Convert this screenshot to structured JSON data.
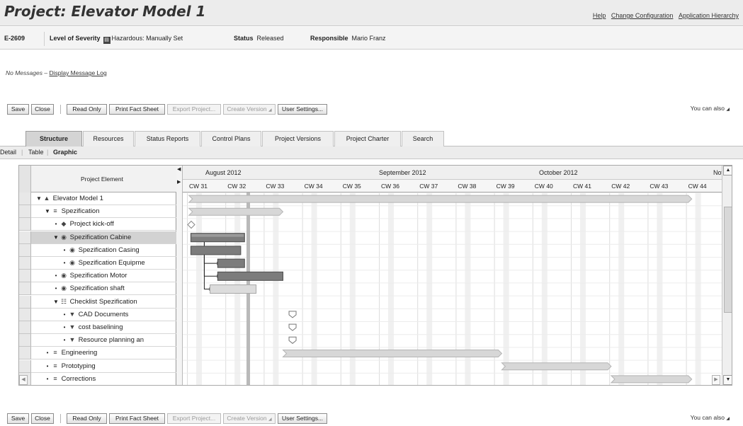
{
  "app": {
    "title": "Project: Elevator Model 1"
  },
  "top_links": [
    "Help",
    "Change Configuration",
    "Application Hierarchy"
  ],
  "header": {
    "id": "E-2609",
    "severity_label": "Level of Severity",
    "severity_value": "Hazardous: Manually Set",
    "status_label": "Status",
    "status_value": "Released",
    "responsible_label": "Responsible",
    "responsible_value": "Mario Franz"
  },
  "messages": {
    "text": "No Messages",
    "separator": "–",
    "link": "Display Message Log"
  },
  "toolbar": {
    "save": "Save",
    "close": "Close",
    "read_only": "Read Only",
    "print_fact_sheet": "Print Fact Sheet",
    "export_project": "Export Project...",
    "create_version": "Create Version",
    "user_settings": "User Settings...",
    "you_can_also": "You can also"
  },
  "tabs": [
    "Structure",
    "Resources",
    "Status Reports",
    "Control Plans",
    "Project Versions",
    "Project Charter",
    "Search"
  ],
  "subviews": [
    "Detail",
    "Table",
    "Graphic"
  ],
  "grid": {
    "column_header": "Project Element",
    "rows": [
      {
        "label": "Elevator Model 1",
        "icon": "project-triangle-icon",
        "expanded": true
      },
      {
        "label": "Spezification",
        "icon": "phase-icon",
        "expanded": true
      },
      {
        "label": "Project kick-off",
        "icon": "milestone-diamond-icon"
      },
      {
        "label": "Spezification Cabine",
        "icon": "task-circle-icon",
        "expanded": true,
        "selected": true
      },
      {
        "label": "Spezification Casing",
        "icon": "task-circle-icon"
      },
      {
        "label": "Spezification Equipme",
        "icon": "task-circle-icon"
      },
      {
        "label": "Spezification Motor",
        "icon": "task-circle-icon"
      },
      {
        "label": "Spezification shaft",
        "icon": "task-circle-icon"
      },
      {
        "label": "Checklist Spezification",
        "icon": "checklist-icon",
        "expanded": true
      },
      {
        "label": "CAD Documents",
        "icon": "checklist-item-icon"
      },
      {
        "label": "cost baselining",
        "icon": "checklist-item-icon"
      },
      {
        "label": "Resource planning an",
        "icon": "checklist-item-icon"
      },
      {
        "label": "Engineering",
        "icon": "phase-icon"
      },
      {
        "label": "Prototyping",
        "icon": "phase-icon"
      },
      {
        "label": "Corrections",
        "icon": "phase-icon"
      }
    ]
  },
  "timeline": {
    "months": [
      "August 2012",
      "September 2012",
      "October 2012",
      "Nov"
    ],
    "weeks": [
      "CW 31",
      "CW 32",
      "CW 33",
      "CW 34",
      "CW 35",
      "CW 36",
      "CW 37",
      "CW 38",
      "CW 39",
      "CW 40",
      "CW 41",
      "CW 42",
      "CW 43",
      "CW 44"
    ]
  },
  "gantt": {
    "bars": [
      {
        "row": 0,
        "type": "summary",
        "start": 31.05,
        "end": 44.15
      },
      {
        "row": 1,
        "type": "summary",
        "start": 31.05,
        "end": 33.5
      },
      {
        "row": 2,
        "type": "milestone",
        "at": 31.0
      },
      {
        "row": 3,
        "type": "task-dark",
        "start": 31.1,
        "end": 32.5,
        "selected": true
      },
      {
        "row": 4,
        "type": "task-dark",
        "start": 31.1,
        "end": 32.4
      },
      {
        "row": 5,
        "type": "task-dark",
        "start": 31.8,
        "end": 32.5
      },
      {
        "row": 6,
        "type": "task-dark",
        "start": 31.8,
        "end": 33.5
      },
      {
        "row": 7,
        "type": "task-light",
        "start": 31.6,
        "end": 32.8
      },
      {
        "row": 9,
        "type": "checkpoint",
        "at": 33.75
      },
      {
        "row": 10,
        "type": "checkpoint",
        "at": 33.75
      },
      {
        "row": 11,
        "type": "checkpoint",
        "at": 33.75
      },
      {
        "row": 12,
        "type": "summary",
        "start": 33.5,
        "end": 39.2
      },
      {
        "row": 13,
        "type": "summary",
        "start": 39.2,
        "end": 42.05
      },
      {
        "row": 14,
        "type": "summary",
        "start": 42.05,
        "end": 44.15
      }
    ],
    "today_week": 32.55,
    "links": [
      {
        "from_row": 3,
        "to_row": 5
      },
      {
        "from_row": 3,
        "to_row": 6
      },
      {
        "from_row": 4,
        "to_row": 7
      }
    ]
  }
}
